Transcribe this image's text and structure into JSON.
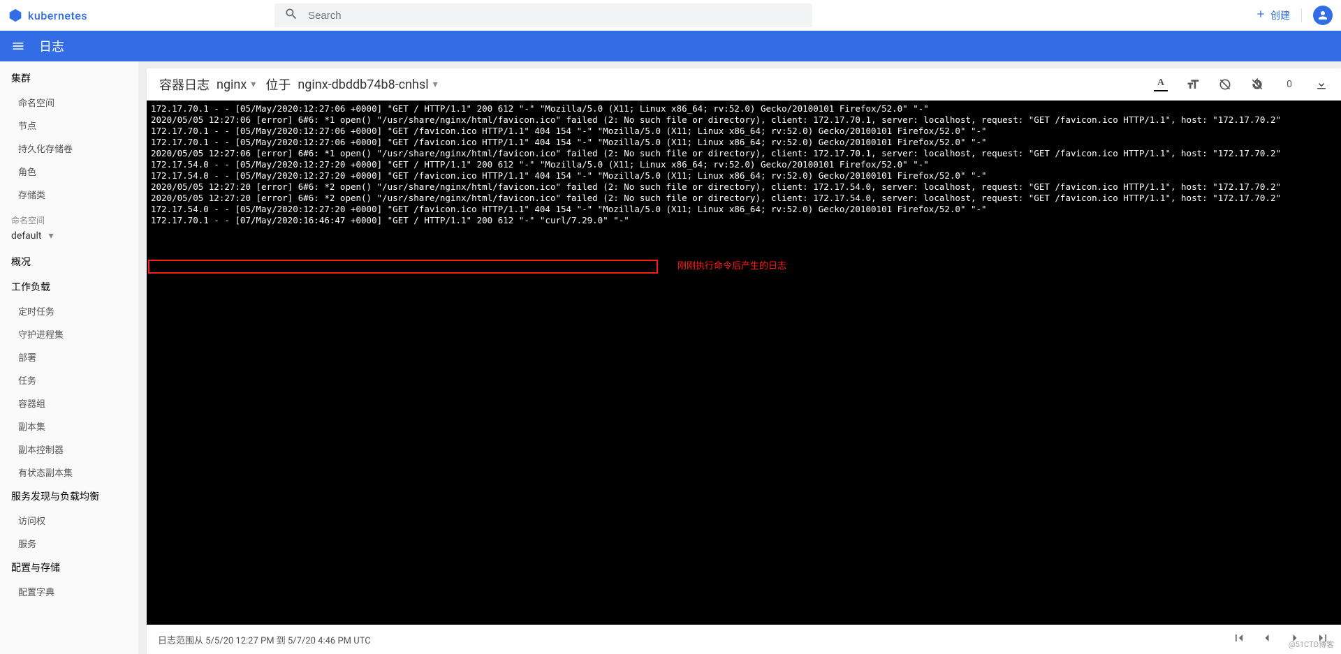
{
  "brand": "kubernetes",
  "search": {
    "placeholder": "Search"
  },
  "header": {
    "create_label": "创建"
  },
  "appbar": {
    "title": "日志"
  },
  "sidebar": {
    "cluster": {
      "title": "集群",
      "items": [
        "命名空间",
        "节点",
        "持久化存储卷",
        "角色",
        "存储类"
      ]
    },
    "ns_label": "命名空间",
    "ns_value": "default",
    "overview": "概况",
    "workloads": {
      "title": "工作负载",
      "items": [
        "定时任务",
        "守护进程集",
        "部署",
        "任务",
        "容器组",
        "副本集",
        "副本控制器",
        "有状态副本集"
      ]
    },
    "discovery": {
      "title": "服务发现与负载均衡",
      "items": [
        "访问权",
        "服务"
      ]
    },
    "config": {
      "title": "配置与存储",
      "items": [
        "配置字典"
      ]
    }
  },
  "card": {
    "title_prefix": "容器日志",
    "container": "nginx",
    "locate_label": "位于",
    "pod": "nginx-dbddb74b8-cnhsl",
    "count": "0"
  },
  "logs": [
    "172.17.70.1 - - [05/May/2020:12:27:06 +0000] \"GET / HTTP/1.1\" 200 612 \"-\" \"Mozilla/5.0 (X11; Linux x86_64; rv:52.0) Gecko/20100101 Firefox/52.0\" \"-\"",
    "2020/05/05 12:27:06 [error] 6#6: *1 open() \"/usr/share/nginx/html/favicon.ico\" failed (2: No such file or directory), client: 172.17.70.1, server: localhost, request: \"GET /favicon.ico HTTP/1.1\", host: \"172.17.70.2\"",
    "172.17.70.1 - - [05/May/2020:12:27:06 +0000] \"GET /favicon.ico HTTP/1.1\" 404 154 \"-\" \"Mozilla/5.0 (X11; Linux x86_64; rv:52.0) Gecko/20100101 Firefox/52.0\" \"-\"",
    "172.17.70.1 - - [05/May/2020:12:27:06 +0000] \"GET /favicon.ico HTTP/1.1\" 404 154 \"-\" \"Mozilla/5.0 (X11; Linux x86_64; rv:52.0) Gecko/20100101 Firefox/52.0\" \"-\"",
    "2020/05/05 12:27:06 [error] 6#6: *1 open() \"/usr/share/nginx/html/favicon.ico\" failed (2: No such file or directory), client: 172.17.70.1, server: localhost, request: \"GET /favicon.ico HTTP/1.1\", host: \"172.17.70.2\"",
    "172.17.54.0 - - [05/May/2020:12:27:20 +0000] \"GET / HTTP/1.1\" 200 612 \"-\" \"Mozilla/5.0 (X11; Linux x86_64; rv:52.0) Gecko/20100101 Firefox/52.0\" \"-\"",
    "172.17.54.0 - - [05/May/2020:12:27:20 +0000] \"GET /favicon.ico HTTP/1.1\" 404 154 \"-\" \"Mozilla/5.0 (X11; Linux x86_64; rv:52.0) Gecko/20100101 Firefox/52.0\" \"-\"",
    "2020/05/05 12:27:20 [error] 6#6: *2 open() \"/usr/share/nginx/html/favicon.ico\" failed (2: No such file or directory), client: 172.17.54.0, server: localhost, request: \"GET /favicon.ico HTTP/1.1\", host: \"172.17.70.2\"",
    "2020/05/05 12:27:20 [error] 6#6: *2 open() \"/usr/share/nginx/html/favicon.ico\" failed (2: No such file or directory), client: 172.17.54.0, server: localhost, request: \"GET /favicon.ico HTTP/1.1\", host: \"172.17.70.2\"",
    "172.17.54.0 - - [05/May/2020:12:27:20 +0000] \"GET /favicon.ico HTTP/1.1\" 404 154 \"-\" \"Mozilla/5.0 (X11; Linux x86_64; rv:52.0) Gecko/20100101 Firefox/52.0\" \"-\"",
    "172.17.70.1 - - [07/May/2020:16:46:47 +0000] \"GET / HTTP/1.1\" 200 612 \"-\" \"curl/7.29.0\" \"-\""
  ],
  "annotation_text": "刚刚执行命令后产生的日志",
  "footer": {
    "range": "日志范围从 5/5/20 12:27 PM 到 5/7/20 4:46 PM UTC"
  },
  "watermark": "@51CTO博客"
}
